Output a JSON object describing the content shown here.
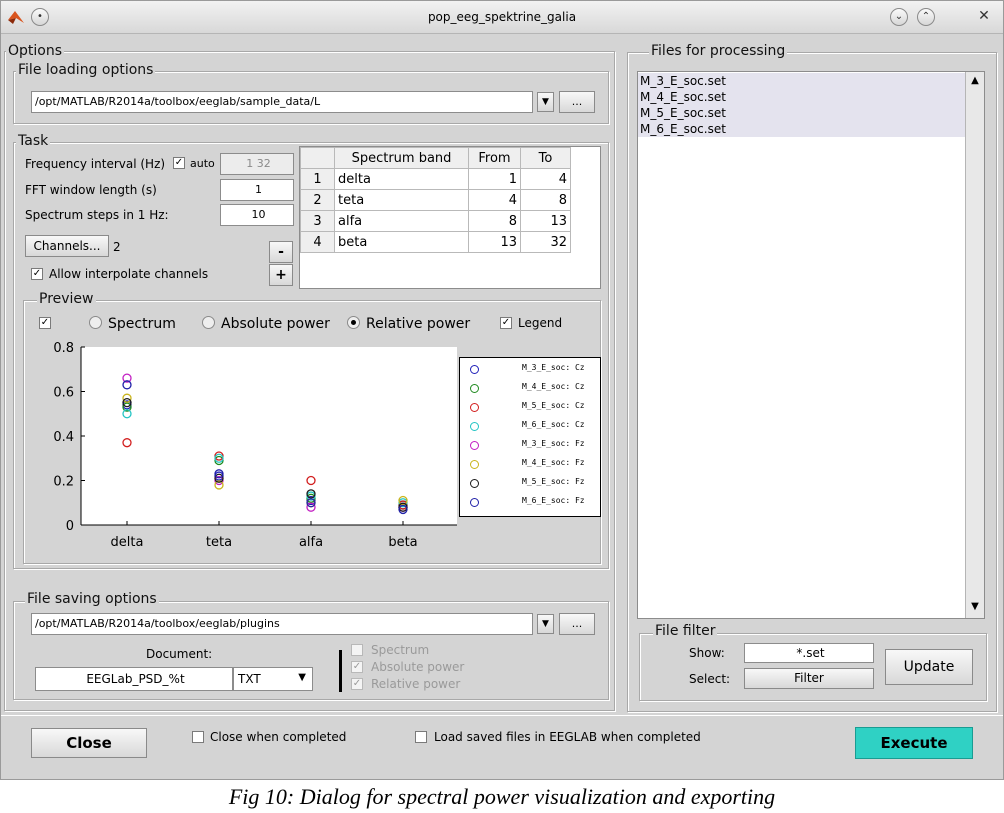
{
  "window": {
    "title": "pop_eeg_spektrine_galia"
  },
  "options": {
    "title": "Options",
    "file_loading": {
      "title": "File loading options",
      "path": "/opt/MATLAB/R2014a/toolbox/eeglab/sample_data/L",
      "browse_label": "..."
    },
    "task": {
      "title": "Task",
      "freq_label": "Frequency interval (Hz)",
      "auto_label": "auto",
      "freq_value": "1 32",
      "fft_label": "FFT window length (s)",
      "fft_value": "1",
      "steps_label": "Spectrum steps in 1 Hz:",
      "steps_value": "10",
      "channels_button": "Channels...",
      "channels_count": "2",
      "interpolate_label": "Allow interpolate channels",
      "minus_label": "-",
      "plus_label": "+",
      "table": {
        "headers": [
          "Spectrum band",
          "From",
          "To"
        ],
        "rows": [
          {
            "idx": "1",
            "band": "delta",
            "from": "1",
            "to": "4"
          },
          {
            "idx": "2",
            "band": "teta",
            "from": "4",
            "to": "8"
          },
          {
            "idx": "3",
            "band": "alfa",
            "from": "8",
            "to": "13"
          },
          {
            "idx": "4",
            "band": "beta",
            "from": "13",
            "to": "32"
          }
        ]
      }
    },
    "preview": {
      "title": "Preview",
      "mode_spectrum": "Spectrum",
      "mode_absolute": "Absolute power",
      "mode_relative": "Relative power",
      "selected_mode": "Relative power",
      "legend_label": "Legend"
    },
    "file_saving": {
      "title": "File saving options",
      "path": "/opt/MATLAB/R2014a/toolbox/eeglab/plugins",
      "browse_label": "...",
      "document_label": "Document:",
      "document_value": "EEGLab_PSD_%t",
      "format_value": "TXT",
      "opt_spectrum": "Spectrum",
      "opt_absolute": "Absolute power",
      "opt_relative": "Relative power"
    }
  },
  "files": {
    "title": "Files for processing",
    "items": [
      "M_3_E_soc.set",
      "M_4_E_soc.set",
      "M_5_E_soc.set",
      "M_6_E_soc.set"
    ],
    "filter": {
      "title": "File filter",
      "show_label": "Show:",
      "show_value": "*.set",
      "select_label": "Select:",
      "filter_button": "Filter",
      "update_button": "Update"
    }
  },
  "bottom": {
    "close_button": "Close",
    "close_when_completed": "Close when completed",
    "load_saved": "Load saved files in EEGLAB when completed",
    "execute_button": "Execute"
  },
  "caption": "Fig 10: Dialog for spectral power visualization and exporting",
  "colors": {
    "window_bg": "#d4d4d4",
    "execute_bg": "#2fd1c4"
  },
  "chart_data": {
    "type": "scatter",
    "categories": [
      "delta",
      "teta",
      "alfa",
      "beta"
    ],
    "ylim": [
      0,
      0.8
    ],
    "yticks": [
      "0",
      "0.2",
      "0.4",
      "0.6",
      "0.8"
    ],
    "series": [
      {
        "name": "M_3_E_soc: Cz",
        "color": "#1f1fb8",
        "values": [
          0.54,
          0.22,
          0.11,
          0.09
        ]
      },
      {
        "name": "M_4_E_soc: Cz",
        "color": "#1e8a1e",
        "values": [
          0.53,
          0.29,
          0.12,
          0.09
        ]
      },
      {
        "name": "M_5_E_soc: Cz",
        "color": "#d21e1e",
        "values": [
          0.37,
          0.31,
          0.2,
          0.09
        ]
      },
      {
        "name": "M_6_E_soc: Cz",
        "color": "#22c4c4",
        "values": [
          0.5,
          0.3,
          0.13,
          0.1
        ]
      },
      {
        "name": "M_3_E_soc: Fz",
        "color": "#c21ec2",
        "values": [
          0.66,
          0.2,
          0.08,
          0.08
        ]
      },
      {
        "name": "M_4_E_soc: Fz",
        "color": "#c9b41a",
        "values": [
          0.57,
          0.18,
          0.1,
          0.11
        ]
      },
      {
        "name": "M_5_E_soc: Fz",
        "color": "#1a1a1a",
        "values": [
          0.55,
          0.21,
          0.14,
          0.08
        ]
      },
      {
        "name": "M_6_E_soc: Fz",
        "color": "#2020a8",
        "values": [
          0.63,
          0.23,
          0.1,
          0.07
        ]
      }
    ]
  }
}
